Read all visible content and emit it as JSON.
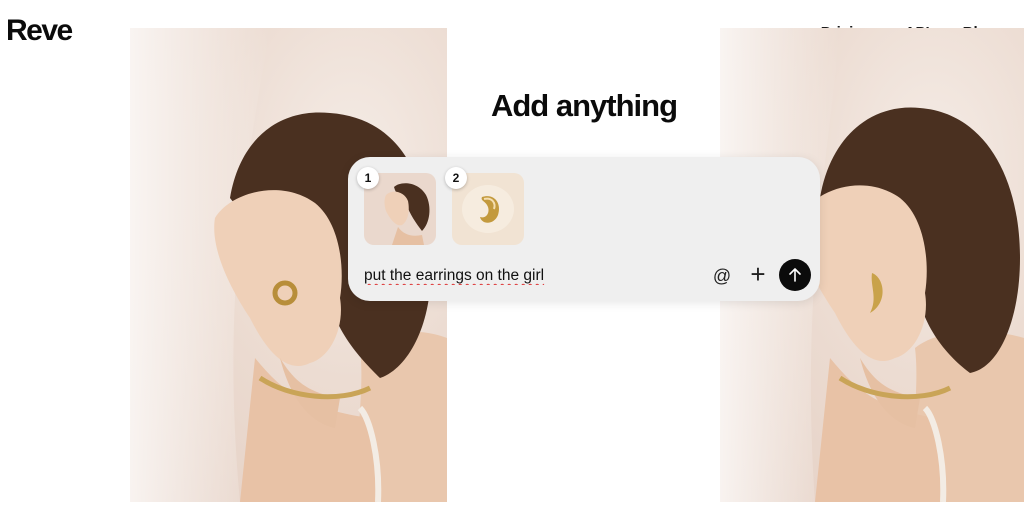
{
  "brand": {
    "name": "Reve"
  },
  "nav": {
    "items": [
      "Pricing",
      "API",
      "Blog"
    ]
  },
  "hero": {
    "headline": "Add anything"
  },
  "composer": {
    "references": [
      {
        "index": "1",
        "icon": "woman-portrait-thumbnail"
      },
      {
        "index": "2",
        "icon": "gold-earring-thumbnail"
      }
    ],
    "prompt_value": "put the earrings on the girl",
    "mention_icon": "@",
    "add_icon": "+",
    "send_icon": "arrow-up-icon"
  },
  "images": {
    "left": "woman-portrait-before",
    "right": "woman-portrait-with-earrings"
  },
  "colors": {
    "accent": "#0b0b0b",
    "composer_bg": "#efefef",
    "background": "#ffffff"
  }
}
